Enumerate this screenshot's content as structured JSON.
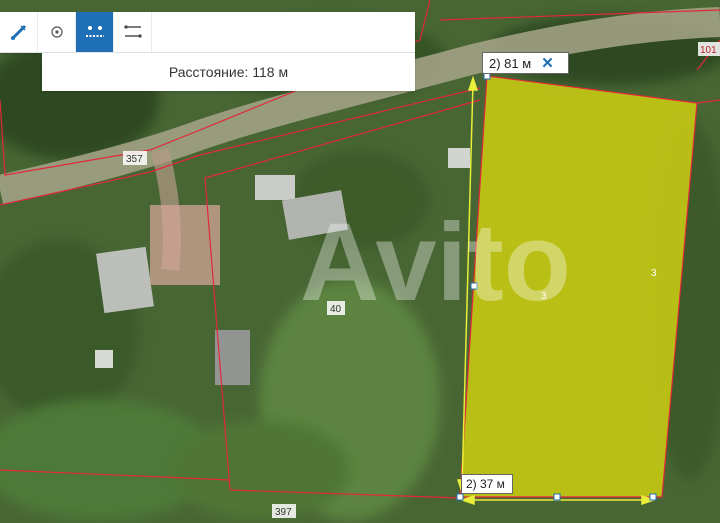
{
  "toolbar": {
    "tools": [
      {
        "icon": "ruler-pen-icon",
        "active": false
      },
      {
        "icon": "point-icon",
        "active": false
      },
      {
        "icon": "area-measure-icon",
        "active": true
      },
      {
        "icon": "distance-measure-icon",
        "active": false
      }
    ],
    "accent_color": "#1f6fb6"
  },
  "distance_panel": {
    "text": "Расстояние: 118 м"
  },
  "measurements": {
    "vertical_label": "2) 81 м",
    "horizontal_label": "2) 37 м"
  },
  "map_labels": {
    "parcel_357": "357",
    "parcel_40": "40",
    "parcel_397": "397",
    "parcel_101": "101",
    "parcel_3_a": "3",
    "parcel_3_b": "3"
  },
  "watermark": "Avito",
  "colors": {
    "highlight_fill": "#c9cc12",
    "boundary": "#e2283a",
    "measure_line": "#e9ee3a"
  }
}
